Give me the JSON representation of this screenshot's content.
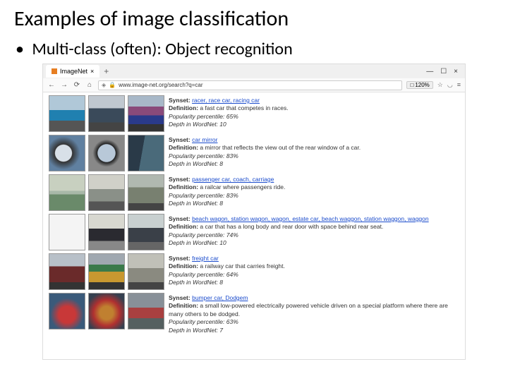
{
  "slide": {
    "title": "Examples of image classification",
    "bullet": "Multi-class (often): Object recognition"
  },
  "browser": {
    "tab": {
      "label": "ImageNet"
    },
    "tabPlus": "+",
    "win": {
      "min": "—",
      "max": "☐",
      "close": "×"
    },
    "nav": {
      "back": "←",
      "fwd": "→",
      "reload": "⟳",
      "home": "⌂"
    },
    "shield": "◈",
    "lock": "🔒",
    "url": "www.image-net.org/search?q=car",
    "zoomIcon": "□",
    "zoom": "120%",
    "icons": {
      "star": "☆",
      "pocket": "◡",
      "menu": "≡"
    }
  },
  "labels": {
    "synset": "Synset:",
    "definition": "Definition:",
    "popularity": "Popularity percentile:",
    "depth": "Depth in WordNet:"
  },
  "rows": [
    {
      "synset": "racer, race car, racing car",
      "definition": "a fast car that competes in races.",
      "popularity": "65%",
      "depth": "10"
    },
    {
      "synset": "car mirror",
      "definition": "a mirror that reflects the view out of the rear window of a car.",
      "popularity": "83%",
      "depth": "8"
    },
    {
      "synset": "passenger car, coach, carriage",
      "definition": "a railcar where passengers ride.",
      "popularity": "83%",
      "depth": "8"
    },
    {
      "synset": "beach wagon, station wagon, wagon, estate car, beach waggon, station waggon, waggon",
      "definition": "a car that has a long body and rear door with space behind rear seat.",
      "popularity": "74%",
      "depth": "10"
    },
    {
      "synset": "freight car",
      "definition": "a railway car that carries freight.",
      "popularity": "64%",
      "depth": "8"
    },
    {
      "synset": "bumper car, Dodgem",
      "definition": "a small low-powered electrically powered vehicle driven on a special platform where there are many others to be dodged.",
      "popularity": "63%",
      "depth": "7"
    }
  ]
}
